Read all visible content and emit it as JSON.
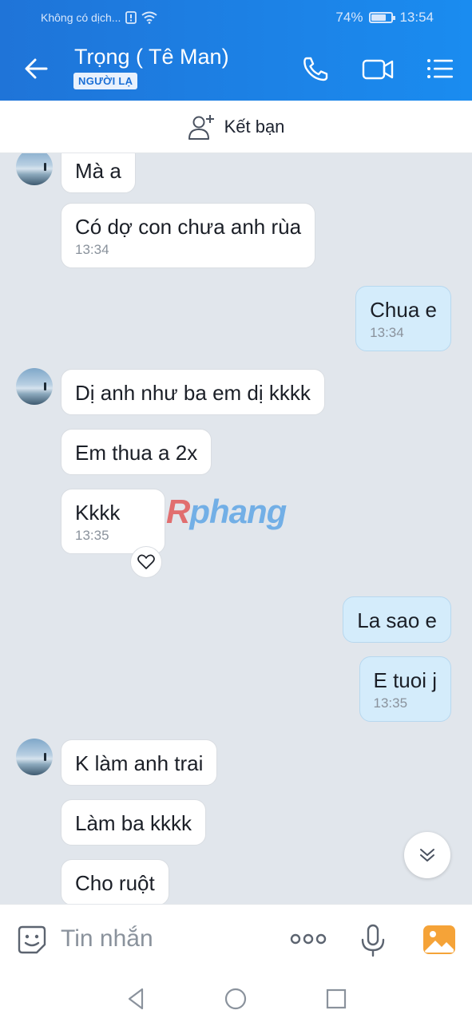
{
  "status_bar": {
    "carrier": "Không có dịch...",
    "battery_percent": "74%",
    "battery_level": 0.74,
    "time": "13:54"
  },
  "header": {
    "title": "Trọng ( Tê Man)",
    "badge": "NGƯỜI LẠ",
    "icons": [
      "back-arrow-icon",
      "phone-icon",
      "video-icon",
      "menu-list-icon"
    ]
  },
  "friend_bar": {
    "label": "Kết bạn",
    "icon": "add-friend-icon"
  },
  "messages": [
    {
      "side": "in",
      "text": "Mà a",
      "time": ""
    },
    {
      "side": "in",
      "text": "Có dợ con chưa anh rùa",
      "time": "13:34"
    },
    {
      "side": "out",
      "text": "Chua e",
      "time": "13:34"
    },
    {
      "side": "in",
      "text": "Dị anh như ba em dị kkkk",
      "time": ""
    },
    {
      "side": "in",
      "text": "Em thua a 2x",
      "time": ""
    },
    {
      "side": "in",
      "text": "Kkkk",
      "time": "13:35"
    },
    {
      "side": "out",
      "text": "La sao e",
      "time": ""
    },
    {
      "side": "out",
      "text": "E tuoi j",
      "time": "13:35"
    },
    {
      "side": "in",
      "text": "K làm anh trai",
      "time": ""
    },
    {
      "side": "in",
      "text": "Làm ba kkkk",
      "time": ""
    },
    {
      "side": "in",
      "text": "Cho ruột",
      "time": ""
    }
  ],
  "watermark": {
    "first": "R",
    "rest": "phang"
  },
  "input": {
    "placeholder": "Tin nhắn"
  },
  "colors": {
    "accent": "#1a8cf0",
    "outgoing_bubble": "#d4ecfb",
    "incoming_bubble": "#ffffff",
    "chat_bg": "#e1e6ec"
  }
}
